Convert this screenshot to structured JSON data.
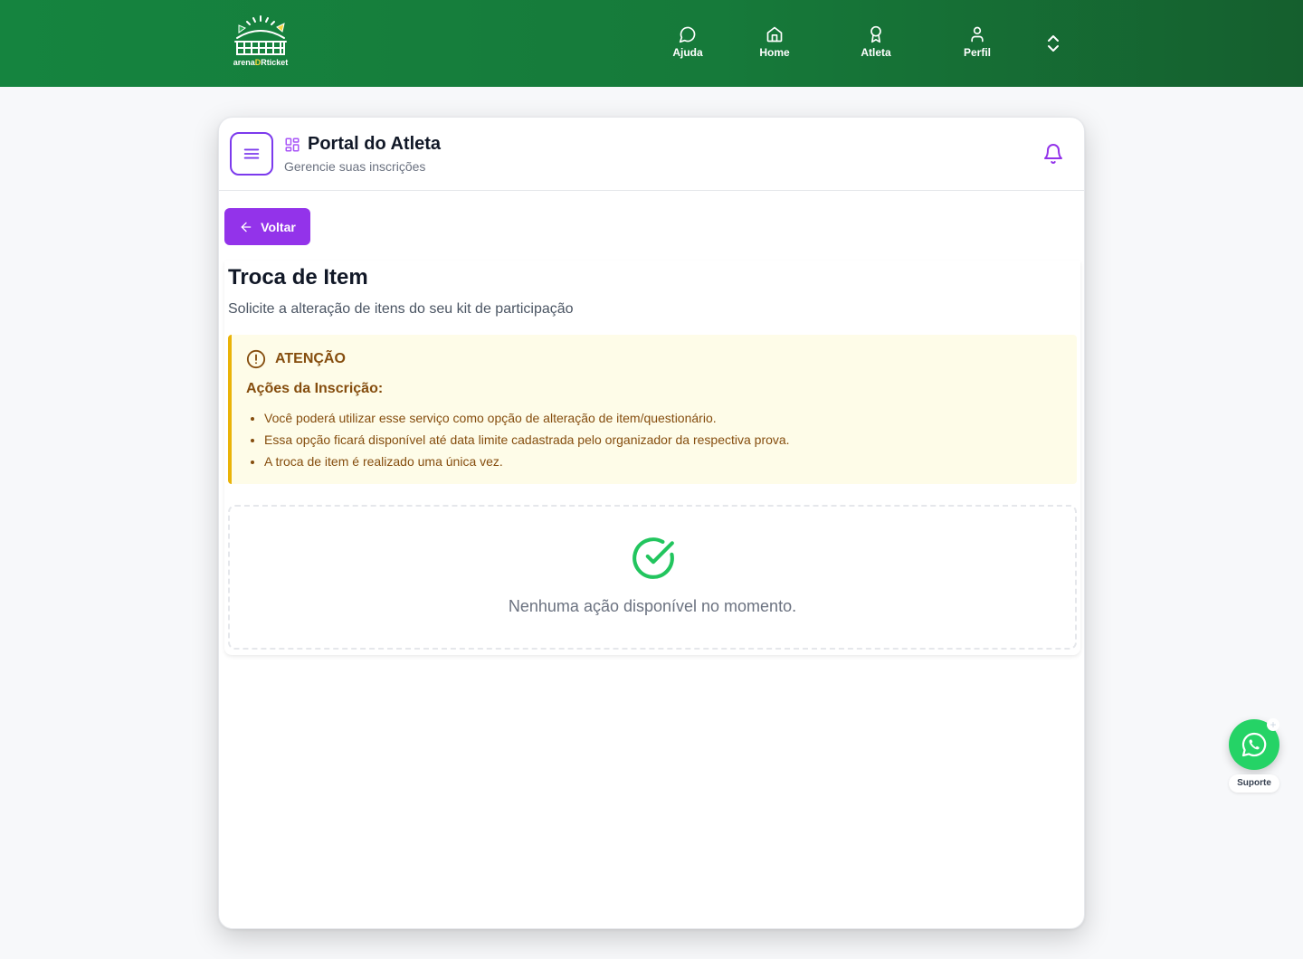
{
  "brand": {
    "logo_text_left": "arena",
    "logo_text_mid": "D",
    "logo_text_right": "Rticket",
    "primary_green": "#15843f",
    "accent_purple": "#9333ea"
  },
  "nav": {
    "items": [
      {
        "label": "Ajuda",
        "icon": "chat-bubble-icon"
      },
      {
        "label": "Home",
        "icon": "home-icon"
      },
      {
        "label": "Atleta",
        "icon": "award-icon"
      },
      {
        "label": "Perfil",
        "icon": "user-icon"
      }
    ],
    "toggle_icon": "chevrons-up-down-icon"
  },
  "portal": {
    "title": "Portal do Atleta",
    "subtitle": "Gerencie suas inscrições"
  },
  "back_button": {
    "label": "Voltar"
  },
  "page": {
    "title": "Troca de Item",
    "subtitle": "Solicite a alteração de itens do seu kit de participação"
  },
  "alert": {
    "title": "ATENÇÃO",
    "subtitle": "Ações da Inscrição:",
    "items": [
      "Você poderá utilizar esse serviço como opção de alteração de item/questionário.",
      "Essa opção ficará disponível até data limite cadastrada pelo organizador da respectiva prova.",
      "A troca de item é realizado uma única vez."
    ]
  },
  "empty_state": {
    "message": "Nenhuma ação disponível no momento."
  },
  "support": {
    "label": "Suporte",
    "plus": "+"
  }
}
